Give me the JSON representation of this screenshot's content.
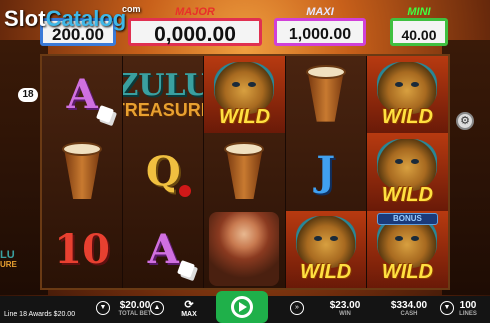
{
  "watermark": {
    "text": "Slot",
    "sub": "Catalog",
    "com": "com"
  },
  "jackpots": [
    {
      "label": "",
      "value": "200.00"
    },
    {
      "label": "MAJOR",
      "value": "0,000.00"
    },
    {
      "label": "MAXI",
      "value": "1,000.00"
    },
    {
      "label": "MINI",
      "value": "40.00"
    }
  ],
  "line_marker": "18",
  "logo": {
    "line1": "ZULU",
    "line2": "TREASURE"
  },
  "side_logo": {
    "line1": "LU",
    "line2": "URE"
  },
  "reels": [
    [
      {
        "type": "letter",
        "text": "A",
        "cls": "l-a",
        "extra": "dice"
      },
      {
        "type": "drum"
      },
      {
        "type": "letter",
        "text": "10",
        "cls": "l-10"
      }
    ],
    [
      {
        "type": "logo"
      },
      {
        "type": "letter",
        "text": "Q",
        "cls": "l-q",
        "extra": "rose"
      },
      {
        "type": "letter",
        "text": "A",
        "cls": "l-a",
        "extra": "dice"
      }
    ],
    [
      {
        "type": "wild",
        "text": "WILD"
      },
      {
        "type": "drum"
      },
      {
        "type": "woman"
      }
    ],
    [
      {
        "type": "drum"
      },
      {
        "type": "letter",
        "text": "J",
        "cls": "l-j"
      },
      {
        "type": "wild",
        "text": "WILD"
      }
    ],
    [
      {
        "type": "wild",
        "text": "WILD"
      },
      {
        "type": "wild",
        "text": "WILD"
      },
      {
        "type": "wild",
        "text": "WILD",
        "bonus": "BONUS"
      }
    ]
  ],
  "bottom": {
    "line_awards": "Line 18 Awards $20.00",
    "total_bet_value": "$20.00",
    "total_bet_label": "TOTAL BET",
    "max_label": "MAX",
    "win_value": "$23.00",
    "win_label": "WIN",
    "cash_value": "$334.00",
    "cash_label": "CASH",
    "lines_value": "100",
    "lines_label": "LINES"
  }
}
